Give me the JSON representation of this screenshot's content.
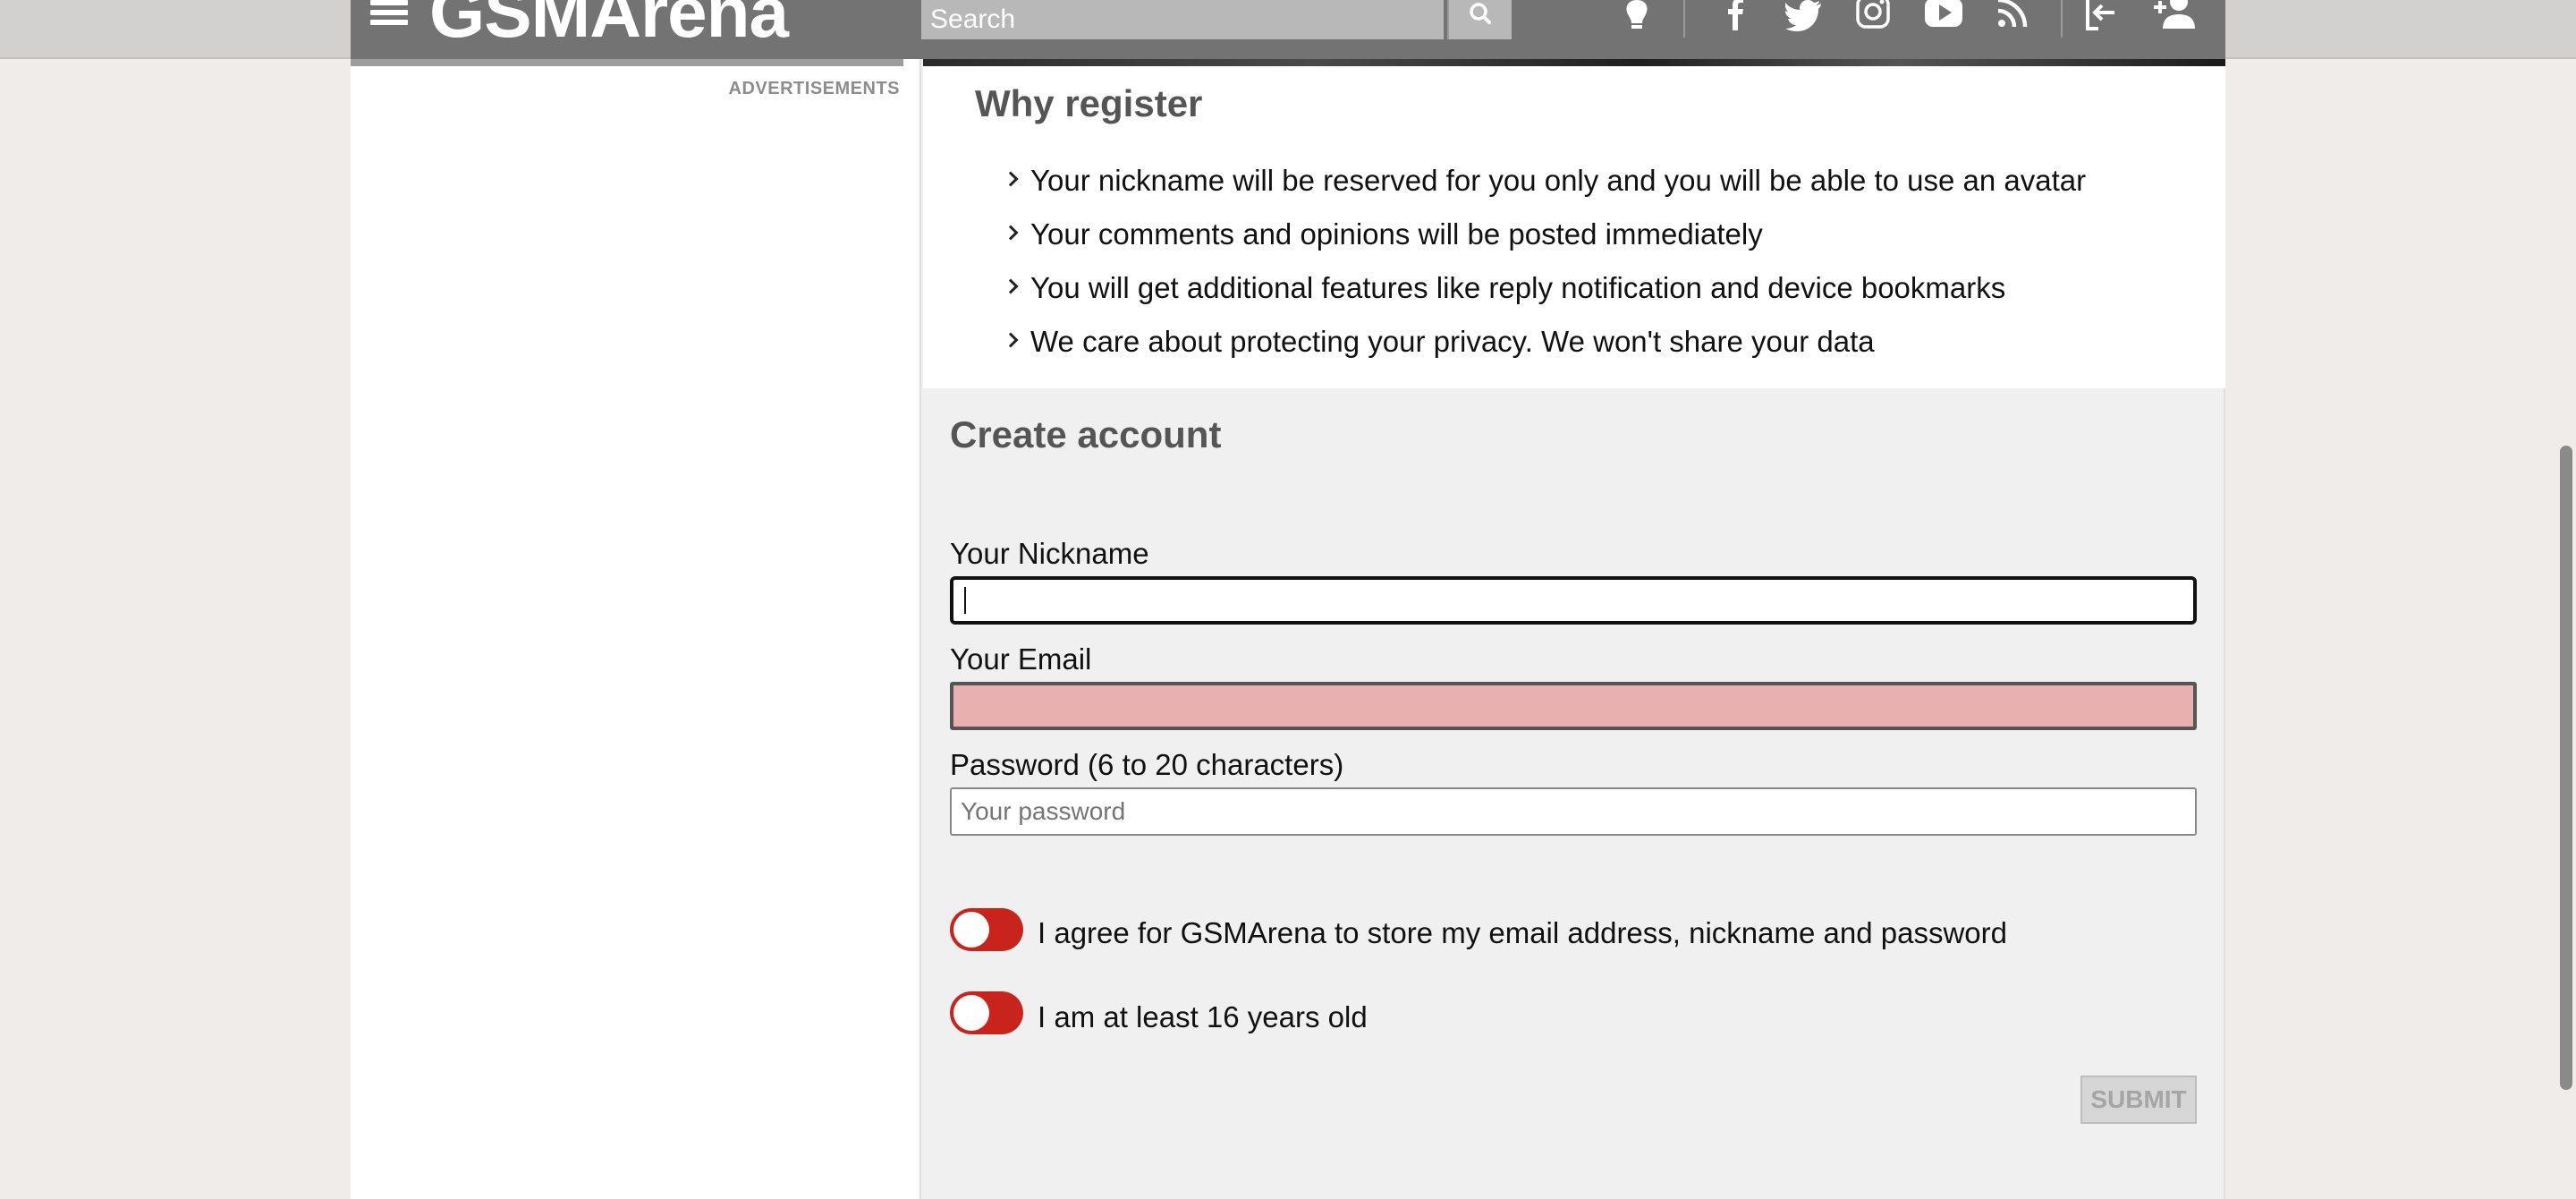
{
  "header": {
    "logo": "GSMArena",
    "search": {
      "placeholder": "Search"
    },
    "icons": [
      "menu-icon",
      "search-icon",
      "lightbulb-icon",
      "facebook-icon",
      "twitter-icon",
      "instagram-icon",
      "youtube-icon",
      "rss-icon",
      "login-icon",
      "add-user-icon"
    ]
  },
  "sidebar": {
    "ad_label": "ADVERTISEMENTS"
  },
  "why_register": {
    "title": "Why register",
    "items": [
      "Your nickname will be reserved for you only and you will be able to use an avatar",
      "Your comments and opinions will be posted immediately",
      "You will get additional features like reply notification and device bookmarks",
      "We care about protecting your privacy. We won't share your data"
    ]
  },
  "create_account": {
    "title": "Create account",
    "nickname": {
      "label": "Your Nickname",
      "value": "",
      "placeholder": ""
    },
    "email": {
      "label": "Your Email",
      "value": "",
      "placeholder": ""
    },
    "password": {
      "label": "Password (6 to 20 characters)",
      "value": "",
      "placeholder": "Your password"
    },
    "agree_store": {
      "label": "I agree for GSMArena to store my email address, nickname and password",
      "checked": false
    },
    "agree_age": {
      "label": "I am at least 16 years old",
      "checked": false
    },
    "submit_label": "SUBMIT"
  },
  "colors": {
    "header_bg": "#737373",
    "toggle_off": "#c8241c",
    "error_field": "#e8b0b0",
    "page_bg": "#efecea"
  }
}
